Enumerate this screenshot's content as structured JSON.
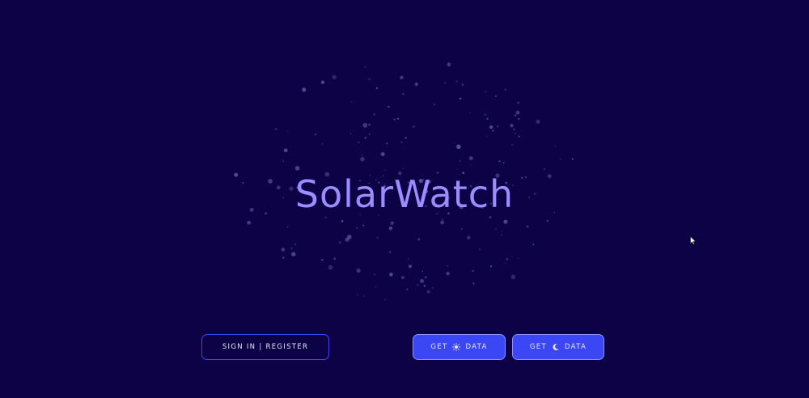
{
  "app": {
    "title": "SolarWatch"
  },
  "actions": {
    "sign_in_label": "SIGN IN | REGISTER",
    "sun_data": {
      "prefix": "GET",
      "icon": "sun-icon",
      "suffix": "DATA"
    },
    "moon_data": {
      "prefix": "GET",
      "icon": "moon-icon",
      "suffix": "DATA"
    }
  },
  "colors": {
    "background": "#0c0245",
    "title": "#9b8cff",
    "accent": "#3b47f5",
    "star": "#5a4fa0"
  }
}
